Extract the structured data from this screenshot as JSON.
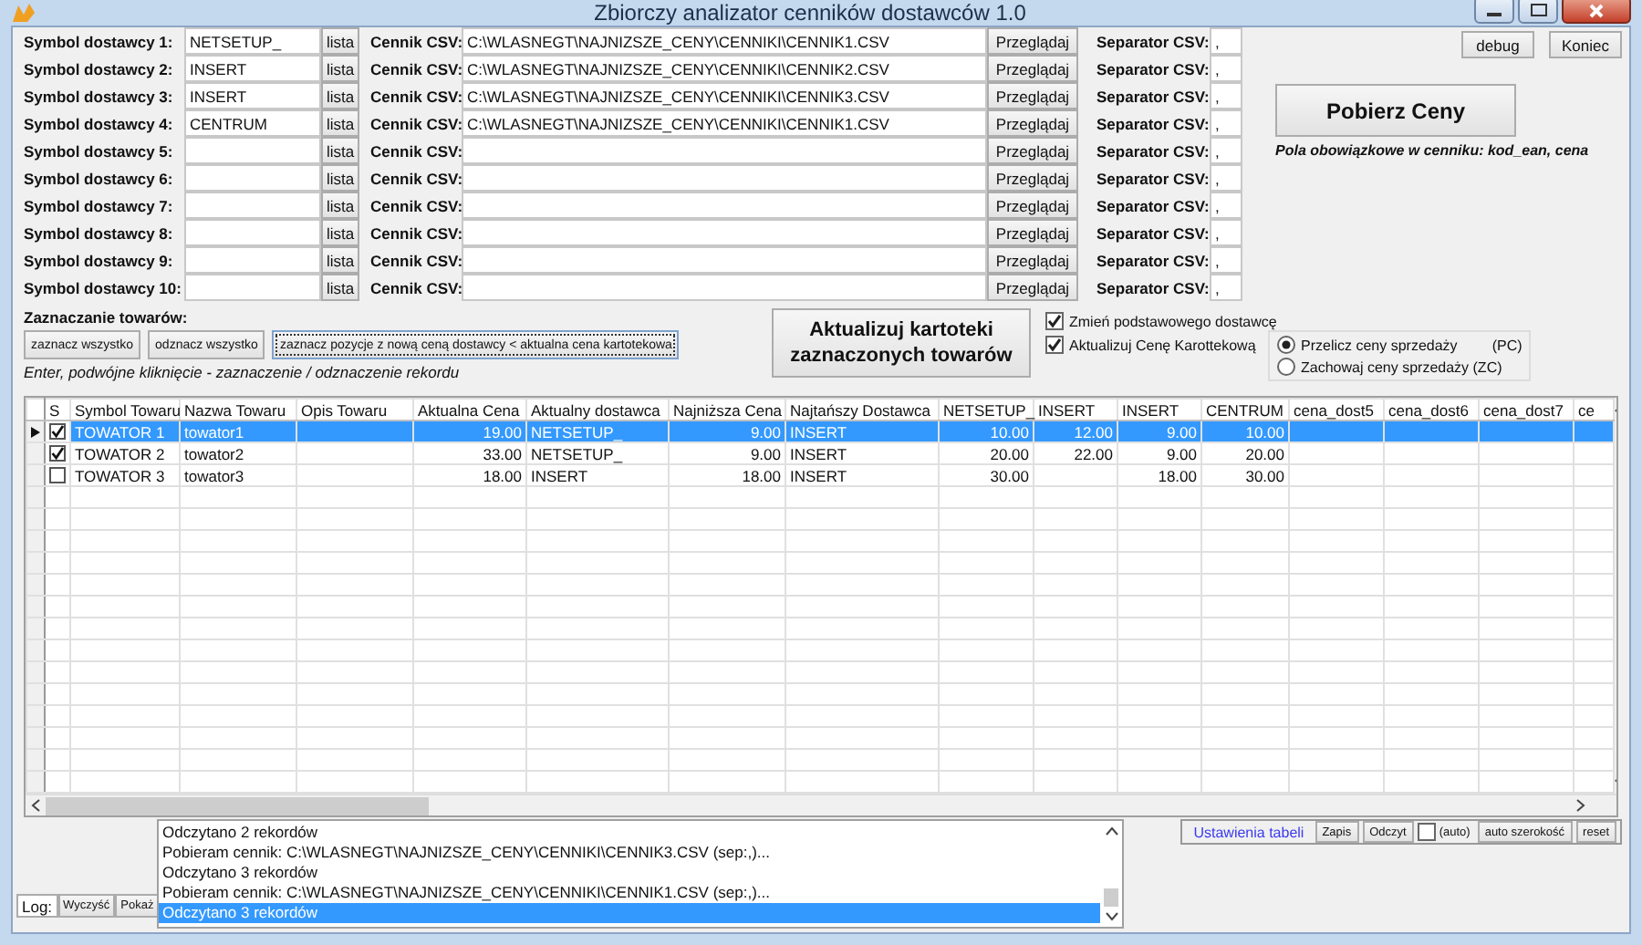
{
  "window": {
    "title": "Zbiorczy analizator cenników dostawców 1.0"
  },
  "suppliers": [
    {
      "label": "Symbol dostawcy 1:",
      "symbol": "NETSETUP_",
      "list_button": "lista",
      "csv_label": "Cennik CSV:",
      "csv_path": "C:\\WLASNEGT\\NAJNIZSZE_CENY\\CENNIKI\\CENNIK1.CSV",
      "browse_button": "Przeglądaj",
      "separator_label": "Separator CSV:",
      "separator": ","
    },
    {
      "label": "Symbol dostawcy 2:",
      "symbol": "INSERT",
      "list_button": "lista",
      "csv_label": "Cennik CSV:",
      "csv_path": "C:\\WLASNEGT\\NAJNIZSZE_CENY\\CENNIKI\\CENNIK2.CSV",
      "browse_button": "Przeglądaj",
      "separator_label": "Separator CSV:",
      "separator": ","
    },
    {
      "label": "Symbol dostawcy 3:",
      "symbol": "INSERT",
      "list_button": "lista",
      "csv_label": "Cennik CSV:",
      "csv_path": "C:\\WLASNEGT\\NAJNIZSZE_CENY\\CENNIKI\\CENNIK3.CSV",
      "browse_button": "Przeglądaj",
      "separator_label": "Separator CSV:",
      "separator": ","
    },
    {
      "label": "Symbol dostawcy 4:",
      "symbol": "CENTRUM",
      "list_button": "lista",
      "csv_label": "Cennik CSV:",
      "csv_path": "C:\\WLASNEGT\\NAJNIZSZE_CENY\\CENNIKI\\CENNIK1.CSV",
      "browse_button": "Przeglądaj",
      "separator_label": "Separator CSV:",
      "separator": ","
    },
    {
      "label": "Symbol dostawcy 5:",
      "list_button": "lista",
      "csv_label": "Cennik CSV:",
      "browse_button": "Przeglądaj",
      "separator_label": "Separator CSV:",
      "separator": ","
    },
    {
      "label": "Symbol dostawcy 6:",
      "list_button": "lista",
      "csv_label": "Cennik CSV:",
      "browse_button": "Przeglądaj",
      "separator_label": "Separator CSV:",
      "separator": ","
    },
    {
      "label": "Symbol dostawcy 7:",
      "list_button": "lista",
      "csv_label": "Cennik CSV:",
      "browse_button": "Przeglądaj",
      "separator_label": "Separator CSV:",
      "separator": ","
    },
    {
      "label": "Symbol dostawcy 8:",
      "list_button": "lista",
      "csv_label": "Cennik CSV:",
      "browse_button": "Przeglądaj",
      "separator_label": "Separator CSV:",
      "separator": ","
    },
    {
      "label": "Symbol dostawcy 9:",
      "list_button": "lista",
      "csv_label": "Cennik CSV:",
      "browse_button": "Przeglądaj",
      "separator_label": "Separator CSV:",
      "separator": ","
    },
    {
      "label": "Symbol dostawcy 10:",
      "list_button": "lista",
      "csv_label": "Cennik CSV:",
      "browse_button": "Przeglądaj",
      "separator_label": "Separator CSV:",
      "separator": ","
    }
  ],
  "top_buttons": [
    "debug",
    "Koniec"
  ],
  "fetch_button": "Pobierz Ceny",
  "required_note": "Pola obowiązkowe w cenniku: kod_ean, cena",
  "selection": {
    "title": "Zaznaczanie towarów:",
    "buttons": [
      {
        "label": "zaznacz wszystko",
        "focused": false
      },
      {
        "label": "odznacz wszystko",
        "focused": false
      },
      {
        "label": "zaznacz pozycje z  nową ceną dostawcy < aktualna cena kartotekowa",
        "focused": true
      }
    ],
    "hint": "Enter, podwójne kliknięcie - zaznaczenie / odznaczenie rekordu"
  },
  "update_button": "Aktualizuj kartoteki zaznaczonych towarów",
  "options": [
    {
      "label": "Zmień podstawowego dostawcę",
      "checked": true
    },
    {
      "label": "Aktualizuj Cenę Karottekową",
      "checked": true
    }
  ],
  "price_mode": [
    {
      "label": "Przelicz ceny sprzedaży",
      "code": "(PC)",
      "selected": true
    },
    {
      "label": "Zachowaj ceny sprzedaży (ZC)",
      "selected": false
    }
  ],
  "table": {
    "columns": [
      {
        "label": "S",
        "kind": "check"
      },
      {
        "label": "Symbol Towaru",
        "kind": "text"
      },
      {
        "label": "Nazwa Towaru",
        "kind": "text"
      },
      {
        "label": "Opis Towaru",
        "kind": "text"
      },
      {
        "label": "Aktualna Cena",
        "kind": "number"
      },
      {
        "label": "Aktualny dostawca",
        "kind": "text"
      },
      {
        "label": "Najniższa Cena",
        "kind": "number"
      },
      {
        "label": "Najtańszy Dostawca",
        "kind": "text"
      },
      {
        "label": "NETSETUP_",
        "kind": "number"
      },
      {
        "label": "INSERT",
        "kind": "number"
      },
      {
        "label": "INSERT",
        "kind": "number"
      },
      {
        "label": "CENTRUM",
        "kind": "number"
      },
      {
        "label": "cena_dost5",
        "kind": "number"
      },
      {
        "label": "cena_dost6",
        "kind": "number"
      },
      {
        "label": "cena_dost7",
        "kind": "number"
      },
      {
        "label": "ce",
        "kind": "number"
      }
    ],
    "rows": [
      {
        "current": true,
        "selected": true,
        "checked": true,
        "cells": [
          null,
          "TOWATOR 1",
          "towator1",
          null,
          "19.00",
          "NETSETUP_",
          "9.00",
          "INSERT",
          "10.00",
          "12.00",
          "9.00",
          "10.00",
          null,
          null,
          null,
          null
        ]
      },
      {
        "current": false,
        "selected": false,
        "checked": true,
        "cells": [
          null,
          "TOWATOR 2",
          "towator2",
          null,
          "33.00",
          "NETSETUP_",
          "9.00",
          "INSERT",
          "20.00",
          "22.00",
          "9.00",
          "20.00",
          null,
          null,
          null,
          null
        ]
      },
      {
        "current": false,
        "selected": false,
        "checked": false,
        "cells": [
          null,
          "TOWATOR 3",
          "towator3",
          null,
          "18.00",
          "INSERT",
          "18.00",
          "INSERT",
          "30.00",
          null,
          "18.00",
          "30.00",
          null,
          null,
          null,
          null
        ]
      }
    ]
  },
  "log": {
    "buttons": [
      "Log:",
      "Wyczyść",
      "Pokaż"
    ],
    "entries": [
      {
        "text": "Odczytano 2 rekordów",
        "selected": false
      },
      {
        "text": "Pobieram cennik: C:\\WLASNEGT\\NAJNIZSZE_CENY\\CENNIKI\\CENNIK3.CSV (sep:,)...",
        "selected": false
      },
      {
        "text": "Odczytano 3 rekordów",
        "selected": false
      },
      {
        "text": "Pobieram cennik: C:\\WLASNEGT\\NAJNIZSZE_CENY\\CENNIKI\\CENNIK1.CSV (sep:,)...",
        "selected": false
      },
      {
        "text": "Odczytano 3 rekordów",
        "selected": true
      }
    ]
  },
  "table_settings": {
    "title": "Ustawienia tabeli",
    "save": "Zapis",
    "load": "Odczyt",
    "auto_checked": false,
    "auto_label": "(auto)",
    "auto_width": "auto szerokość",
    "reset": "reset"
  }
}
